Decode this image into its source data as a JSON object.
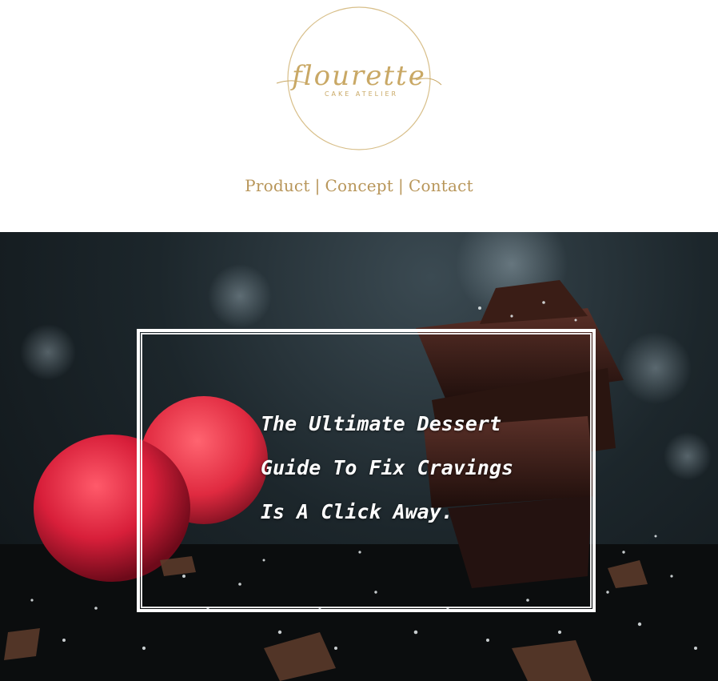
{
  "brand": {
    "name": "flourette",
    "tagline": "CAKE ATELIER",
    "color": "#b8965a"
  },
  "nav": {
    "items": [
      {
        "label": "Product"
      },
      {
        "label": "Concept"
      },
      {
        "label": "Contact"
      }
    ],
    "separator": "|"
  },
  "hero": {
    "headline_lines": [
      "The Ultimate Dessert",
      "Guide To Fix Cravings",
      "Is A Click Away."
    ],
    "image": "raspberries-and-dark-chocolate-photo"
  }
}
